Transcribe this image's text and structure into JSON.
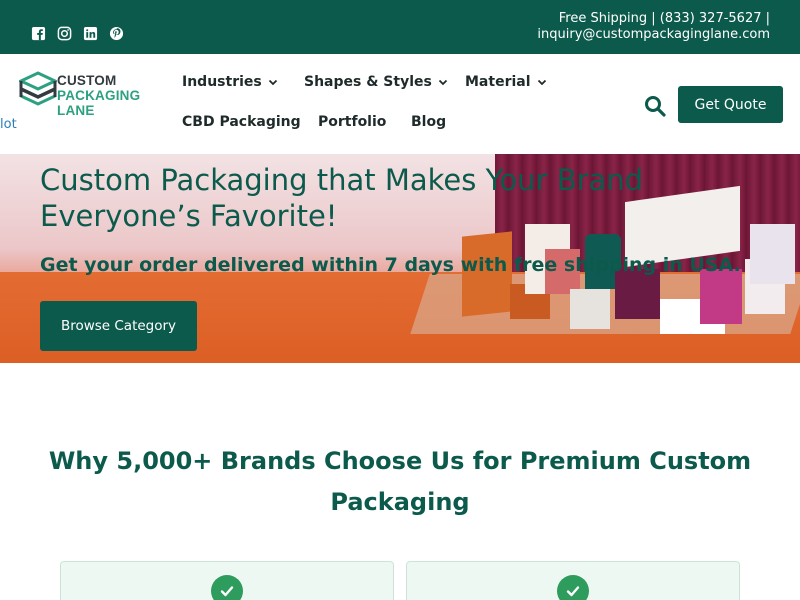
{
  "topbar": {
    "social_icons": [
      "facebook-icon",
      "instagram-icon",
      "linkedin-icon",
      "pinterest-icon"
    ],
    "contact_line1": "Free Shipping | (833) 327-5627 |",
    "contact_line2": "inquiry@custompackaginglane.com"
  },
  "header": {
    "logo_line1": "CUSTOM",
    "logo_line2": "PACKAGING LANE",
    "cut_link": "lot",
    "nav": {
      "industries": "Industries",
      "shapes": "Shapes & Styles",
      "material": "Material",
      "cbd": "CBD Packaging",
      "portfolio": "Portfolio",
      "blog": "Blog"
    },
    "quote_button": "Get Quote"
  },
  "hero": {
    "title_line1": "Custom Packaging that Makes Your Brand",
    "title_line2": "Everyone’s Favorite!",
    "subtitle": "Get your order delivered within 7 days with free shipping in USA.",
    "button": "Browse Category"
  },
  "why": {
    "title_line1": "Why 5,000+ Brands Choose Us for Premium Custom",
    "title_line2": "Packaging"
  },
  "colors": {
    "brand": "#0c5a4c",
    "accent": "#2ea082",
    "check": "#2e9c5d"
  }
}
